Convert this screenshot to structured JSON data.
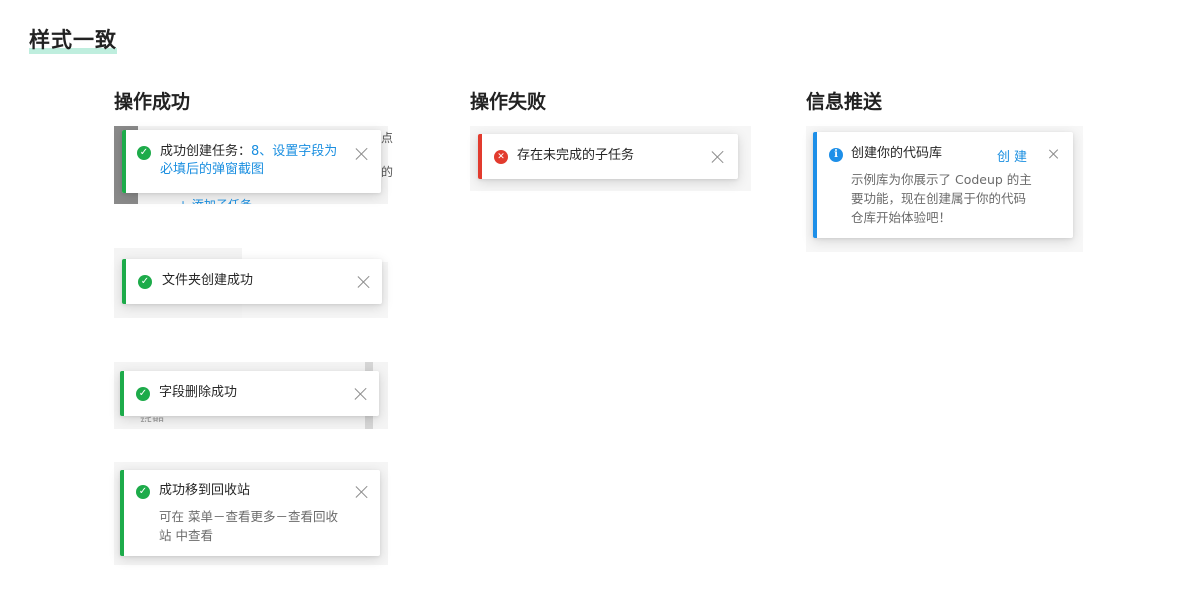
{
  "page_title": "样式一致",
  "columns": {
    "success": "操作成功",
    "failure": "操作失败",
    "info": "信息推送"
  },
  "backdrop_fragments": {
    "dot": "点",
    "de": "的",
    "add_subtask": "+ 添加子任务",
    "misc": "延期"
  },
  "toasts": {
    "create_task": {
      "prefix": "成功创建任务：",
      "link_line1": "8、设置字段为",
      "link_line2": "必填后的弹窗截图"
    },
    "folder_created": {
      "message": "文件夹创建成功"
    },
    "field_deleted": {
      "message": "字段删除成功"
    },
    "moved_recycle": {
      "message": "成功移到回收站",
      "detail_line1": "可在 菜单－查看更多－查看回收",
      "detail_line2": "站 中查看"
    },
    "incomplete_subtask": {
      "message": "存在未完成的子任务"
    },
    "create_repo": {
      "message": "创建你的代码库",
      "action": "创建",
      "detail_line1": "示例库为你展示了 Codeup 的主",
      "detail_line2": "要功能，现在创建属于你的代码",
      "detail_line3": "仓库开始体验吧！"
    }
  },
  "colors": {
    "success": "#1dab4a",
    "error": "#e23b2e",
    "info": "#1d8fe8",
    "link": "#1b8fe0",
    "title_underline": "#bfeede"
  },
  "icons": {
    "success": "check-circle-icon",
    "error": "x-circle-icon",
    "info": "info-circle-icon",
    "close": "close-icon"
  }
}
